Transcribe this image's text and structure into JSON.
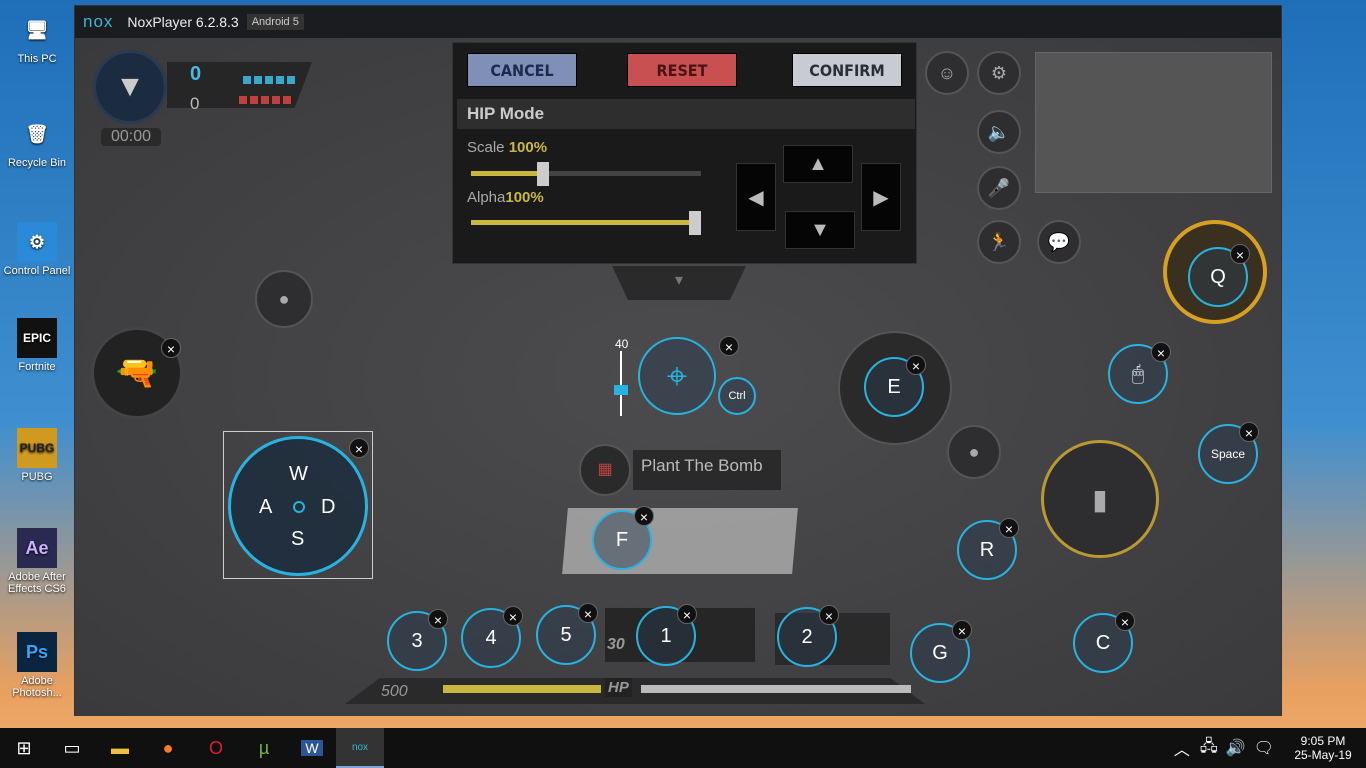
{
  "desktop": {
    "icons": [
      {
        "label": "This PC",
        "glyph": "🖥"
      },
      {
        "label": "Recycle Bin",
        "glyph": "🗑"
      },
      {
        "label": "Control Panel",
        "glyph": "⚙"
      },
      {
        "label": "Fortnite",
        "glyph": "EPIC"
      },
      {
        "label": "PUBG",
        "glyph": "PUBG"
      },
      {
        "label": "Adobe After Effects CS6",
        "glyph": "Ae"
      },
      {
        "label": "Adobe Photosh...",
        "glyph": "Ps"
      }
    ]
  },
  "window": {
    "logo": "nox",
    "title": "NoxPlayer 6.2.8.3",
    "android": "Android 5"
  },
  "hud": {
    "score_blue": "0",
    "score_red": "0",
    "timer": "00:00",
    "plant": "Plant The Bomb",
    "ammo": "500",
    "hp": "HP",
    "ammo_clip": "30"
  },
  "panel": {
    "cancel": "CANCEL",
    "reset": "RESET",
    "confirm": "CONFIRM",
    "mode": "HIP Mode",
    "scale_label": "Scale",
    "scale_value": "100%",
    "alpha_label": "Alpha",
    "alpha_value": "100%",
    "scale_fraction": 0.34,
    "alpha_fraction": 1.0
  },
  "keys": {
    "w": "W",
    "a": "A",
    "s": "S",
    "d": "D",
    "sensitivity": "40",
    "ctrl": "Ctrl",
    "f": "F",
    "e": "E",
    "q": "Q",
    "space": "Space",
    "r": "R",
    "c": "C",
    "g": "G",
    "k1": "1",
    "k2": "2",
    "k3": "3",
    "k4": "4",
    "k5": "5",
    "close": "×"
  },
  "colors": {
    "accent": "#27b3e0",
    "cancel": "#7f8fb8",
    "reset": "#c85050",
    "confirm": "#c8ccd2",
    "yellow": "#c8b840"
  },
  "taskbar": {
    "time": "9:05 PM",
    "date": "25-May-19"
  }
}
